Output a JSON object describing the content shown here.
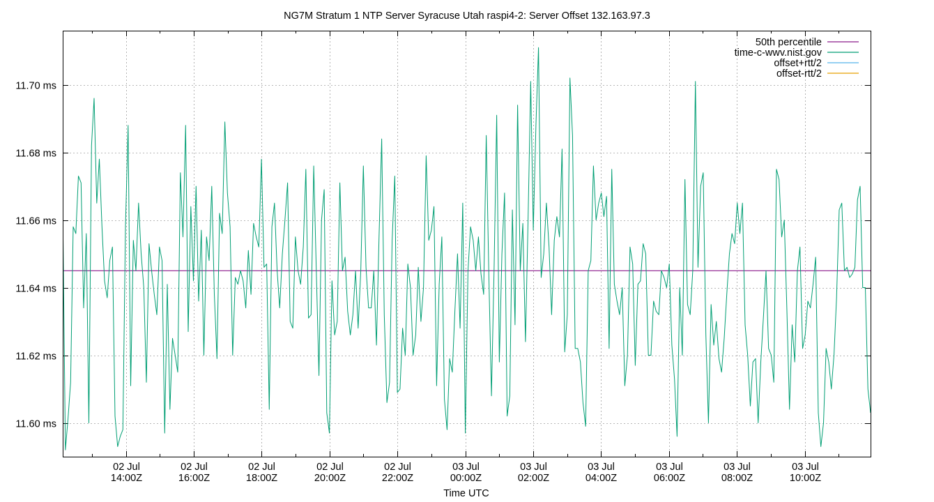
{
  "chart_data": {
    "type": "line",
    "title": "NG7M Stratum 1 NTP Server Syracuse Utah raspi4-2: Server Offset 132.163.97.3",
    "xlabel": "Time UTC",
    "ylabel": "",
    "x_range_hours": [
      12.2,
      12.2
    ],
    "y_unit": "ms",
    "ylim": [
      11.59,
      11.716
    ],
    "y_ticks": [
      {
        "value": 11.6,
        "label": "11.60 ms"
      },
      {
        "value": 11.62,
        "label": "11.62 ms"
      },
      {
        "value": 11.64,
        "label": "11.64 ms"
      },
      {
        "value": 11.66,
        "label": "11.66 ms"
      },
      {
        "value": 11.68,
        "label": "11.68 ms"
      },
      {
        "value": 11.7,
        "label": "11.70 ms"
      }
    ],
    "x_ticks": [
      {
        "date": "02 Jul",
        "time": "14:00Z"
      },
      {
        "date": "02 Jul",
        "time": "16:00Z"
      },
      {
        "date": "02 Jul",
        "time": "18:00Z"
      },
      {
        "date": "02 Jul",
        "time": "20:00Z"
      },
      {
        "date": "02 Jul",
        "time": "22:00Z"
      },
      {
        "date": "03 Jul",
        "time": "00:00Z"
      },
      {
        "date": "03 Jul",
        "time": "02:00Z"
      },
      {
        "date": "03 Jul",
        "time": "04:00Z"
      },
      {
        "date": "03 Jul",
        "time": "06:00Z"
      },
      {
        "date": "03 Jul",
        "time": "08:00Z"
      },
      {
        "date": "03 Jul",
        "time": "10:00Z"
      }
    ],
    "grid": true,
    "legend_position": "top-right",
    "series": [
      {
        "name": "50th percentile",
        "color": "#8b1a8b",
        "constant": 11.645
      },
      {
        "name": "time-c-wwv.nist.gov",
        "color": "#009e73",
        "values": [
          11.664,
          11.592,
          11.601,
          11.612,
          11.658,
          11.656,
          11.673,
          11.671,
          11.634,
          11.656,
          11.6,
          11.682,
          11.696,
          11.665,
          11.678,
          11.658,
          11.642,
          11.637,
          11.648,
          11.652,
          11.602,
          11.593,
          11.596,
          11.598,
          11.658,
          11.688,
          11.611,
          11.654,
          11.645,
          11.665,
          11.65,
          11.64,
          11.612,
          11.653,
          11.645,
          11.638,
          11.632,
          11.652,
          11.648,
          11.597,
          11.641,
          11.604,
          11.625,
          11.62,
          11.615,
          11.674,
          11.655,
          11.688,
          11.627,
          11.664,
          11.642,
          11.67,
          11.636,
          11.657,
          11.62,
          11.655,
          11.648,
          11.67,
          11.638,
          11.619,
          11.662,
          11.656,
          11.689,
          11.668,
          11.658,
          11.62,
          11.643,
          11.641,
          11.645,
          11.642,
          11.634,
          11.651,
          11.638,
          11.659,
          11.655,
          11.652,
          11.678,
          11.646,
          11.647,
          11.604,
          11.658,
          11.665,
          11.645,
          11.634,
          11.65,
          11.66,
          11.671,
          11.63,
          11.628,
          11.655,
          11.645,
          11.641,
          11.652,
          11.675,
          11.631,
          11.632,
          11.676,
          11.645,
          11.614,
          11.66,
          11.669,
          11.603,
          11.597,
          11.642,
          11.626,
          11.63,
          11.671,
          11.645,
          11.649,
          11.633,
          11.626,
          11.632,
          11.645,
          11.628,
          11.645,
          11.676,
          11.646,
          11.634,
          11.634,
          11.645,
          11.623,
          11.655,
          11.684,
          11.632,
          11.606,
          11.612,
          11.654,
          11.673,
          11.609,
          11.61,
          11.628,
          11.62,
          11.647,
          11.64,
          11.62,
          11.626,
          11.646,
          11.63,
          11.64,
          11.679,
          11.654,
          11.657,
          11.664,
          11.611,
          11.641,
          11.655,
          11.607,
          11.598,
          11.619,
          11.615,
          11.633,
          11.65,
          11.628,
          11.665,
          11.597,
          11.645,
          11.658,
          11.654,
          11.645,
          11.655,
          11.644,
          11.638,
          11.685,
          11.643,
          11.608,
          11.646,
          11.691,
          11.618,
          11.65,
          11.668,
          11.602,
          11.608,
          11.663,
          11.629,
          11.694,
          11.645,
          11.659,
          11.624,
          11.66,
          11.701,
          11.657,
          11.688,
          11.711,
          11.643,
          11.65,
          11.665,
          11.652,
          11.632,
          11.654,
          11.661,
          11.655,
          11.681,
          11.621,
          11.632,
          11.702,
          11.685,
          11.622,
          11.622,
          11.618,
          11.606,
          11.599,
          11.645,
          11.648,
          11.676,
          11.66,
          11.665,
          11.668,
          11.661,
          11.667,
          11.622,
          11.675,
          11.641,
          11.636,
          11.632,
          11.64,
          11.611,
          11.62,
          11.652,
          11.647,
          11.617,
          11.641,
          11.642,
          11.653,
          11.65,
          11.62,
          11.62,
          11.636,
          11.633,
          11.632,
          11.645,
          11.643,
          11.64,
          11.647,
          11.623,
          11.613,
          11.596,
          11.64,
          11.62,
          11.672,
          11.635,
          11.632,
          11.645,
          11.701,
          11.646,
          11.67,
          11.674,
          11.626,
          11.6,
          11.635,
          11.623,
          11.63,
          11.619,
          11.615,
          11.625,
          11.638,
          11.65,
          11.656,
          11.653,
          11.665,
          11.656,
          11.665,
          11.629,
          11.62,
          11.605,
          11.618,
          11.619,
          11.6,
          11.618,
          11.631,
          11.645,
          11.622,
          11.62,
          11.612,
          11.675,
          11.672,
          11.655,
          11.66,
          11.633,
          11.604,
          11.629,
          11.618,
          11.645,
          11.652,
          11.622,
          11.626,
          11.636,
          11.634,
          11.641,
          11.649,
          11.603,
          11.593,
          11.6,
          11.622,
          11.618,
          11.61,
          11.62,
          11.637,
          11.663,
          11.665,
          11.645,
          11.646,
          11.643,
          11.644,
          11.646,
          11.666,
          11.67,
          11.64,
          11.64,
          11.61,
          11.603
        ]
      },
      {
        "name": "offset+rtt/2",
        "color": "#56b4e9",
        "values": []
      },
      {
        "name": "offset-rtt/2",
        "color": "#e69f00",
        "values": []
      }
    ]
  }
}
